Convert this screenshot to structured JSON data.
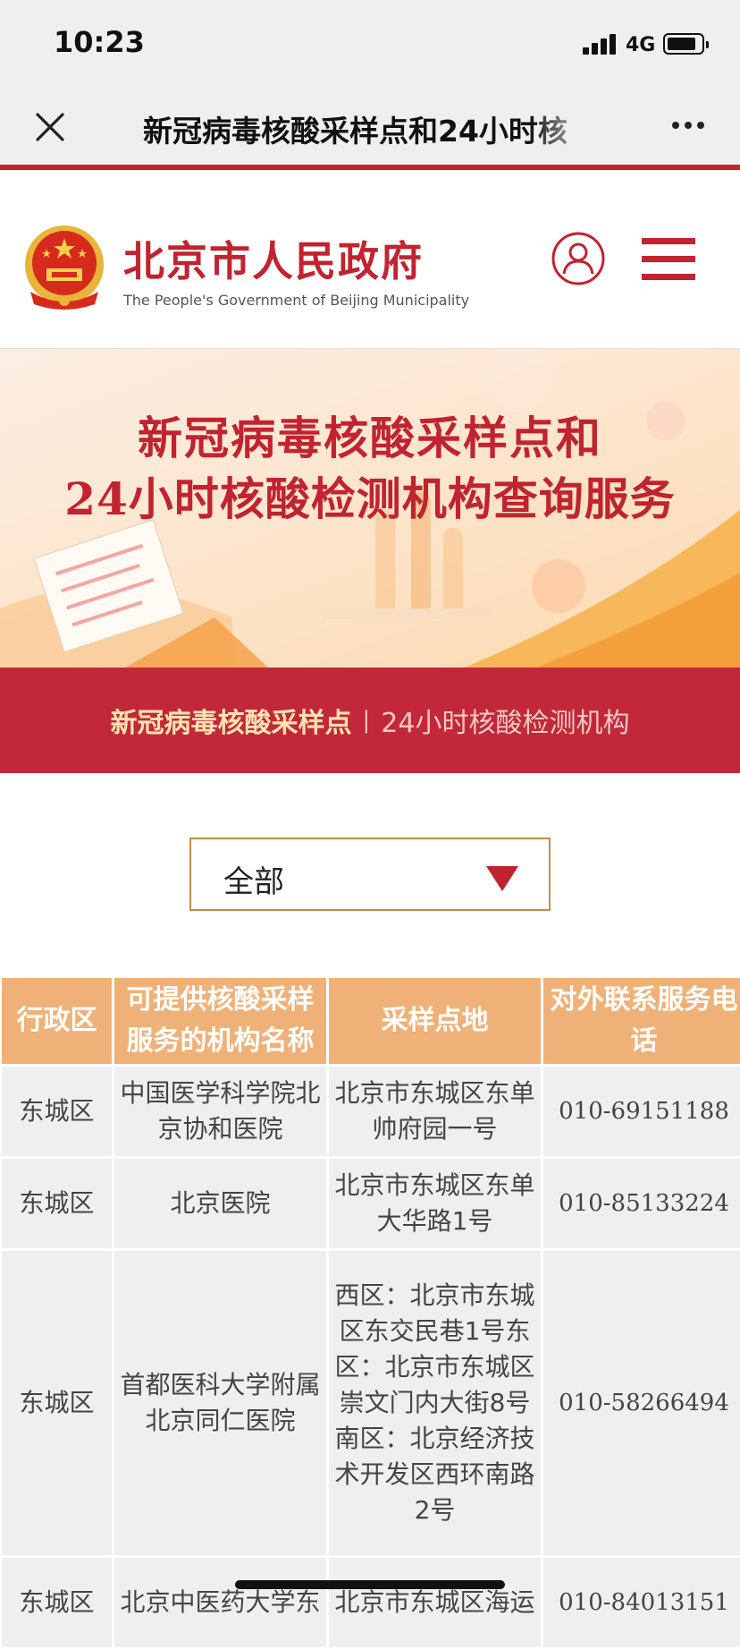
{
  "status_bar": {
    "time": "10:23",
    "network": "4G"
  },
  "nav": {
    "title": "新冠病毒核酸采样点和24小时核"
  },
  "header": {
    "site_name_cn": "北京市人民政府",
    "site_name_en": "The People's Government of Beijing Municipality"
  },
  "banner": {
    "line1": "新冠病毒核酸采样点和",
    "line2": "24小时核酸检测机构查询服务"
  },
  "tabs": {
    "active": "新冠病毒核酸采样点",
    "separator": "|",
    "inactive": "24小时核酸检测机构"
  },
  "filter": {
    "selected": "全部"
  },
  "table": {
    "headers": [
      "行政区",
      "可提供核酸采样服务的机构名称",
      "采样点地",
      "对外联系服务电话"
    ],
    "rows": [
      {
        "district": "东城区",
        "institution": "中国医学科学院北京协和医院",
        "address": "北京市东城区东单帅府园一号",
        "phone": "010-69151188"
      },
      {
        "district": "东城区",
        "institution": "北京医院",
        "address": "北京市东城区东单大华路1号",
        "phone": "010-85133224"
      },
      {
        "district": "东城区",
        "institution": "首都医科大学附属北京同仁医院",
        "address": "西区：北京市东城区东交民巷1号东区：北京市东城区崇文门内大街8号南区：北京经济技术开发区西环南路2号",
        "phone": "010-58266494"
      },
      {
        "district": "东城区",
        "institution": "北京中医药大学东",
        "address": "北京市东城区海运",
        "phone": "010-84013151"
      }
    ]
  },
  "colors": {
    "brand_red": "#c1232f",
    "tab_bar": "#c2283a",
    "table_header": "#f0b178",
    "table_cell": "#efefef"
  }
}
